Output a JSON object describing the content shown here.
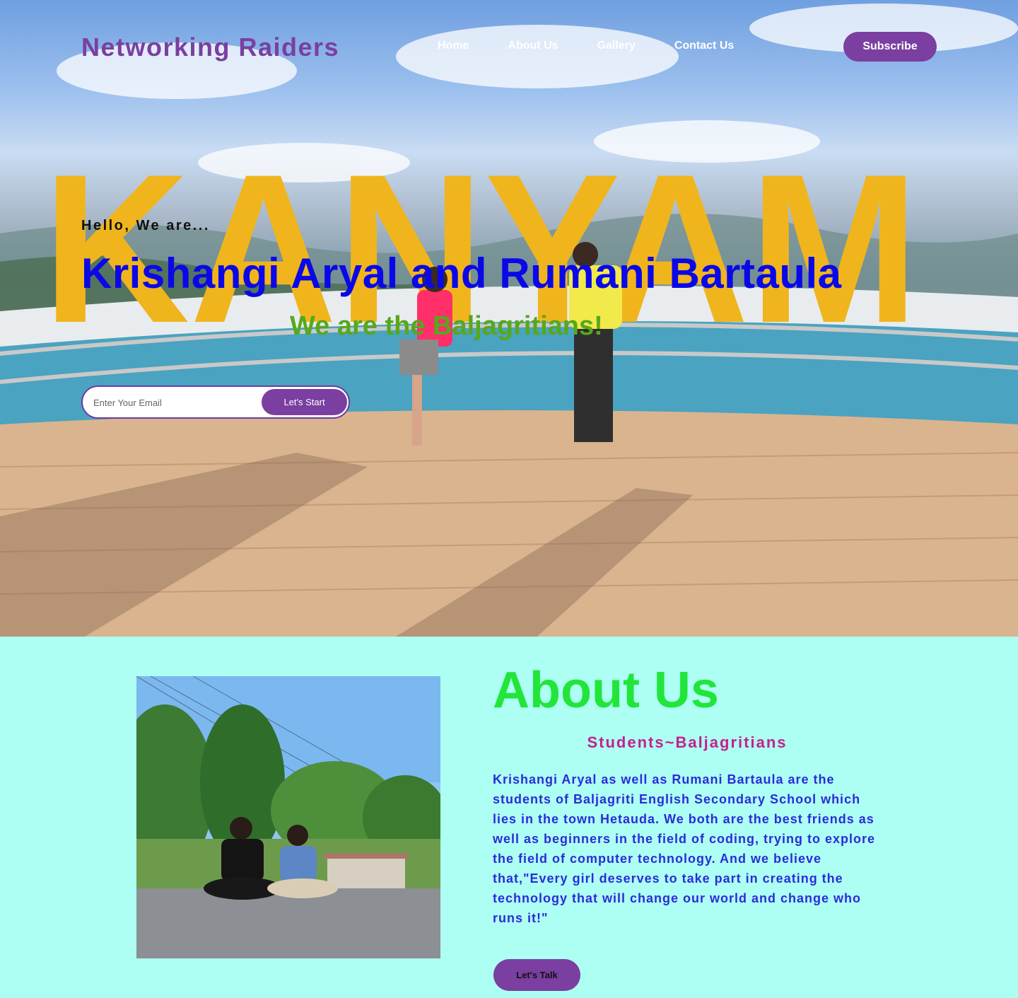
{
  "header": {
    "brand": "Networking Raiders",
    "nav": [
      "Home",
      "About Us",
      "Gallery",
      "Contact Us"
    ],
    "subscribe_label": "Subscribe"
  },
  "hero": {
    "greeting": "Hello, We are...",
    "names": "Krishangi Aryal and Rumani Bartaula",
    "tagline": "We are the Baljagritians!",
    "sign_letters": "KANYAM",
    "email_placeholder": "Enter Your Email",
    "start_label": "Let's Start"
  },
  "about": {
    "title": "About Us",
    "subtitle": "Students~Baljagritians",
    "body": "Krishangi Aryal as well as Rumani Bartaula are the students of Baljagriti English Secondary School which lies in the town Hetauda. We both are the best friends as well as beginners in the field of coding, trying to explore the field of computer technology. And we believe that,\"Every girl deserves to take part in creating the technology that will change our world and change who runs it!\"",
    "talk_label": "Let's Talk"
  },
  "colors": {
    "accent_purple": "#7a3fa0",
    "names_blue": "#0a08e8",
    "tagline_green": "#57a81c",
    "about_title_green": "#22e53a",
    "about_subtitle_pink": "#c4218a",
    "about_text_blue": "#2b2bd9",
    "about_bg": "#adfff4"
  }
}
